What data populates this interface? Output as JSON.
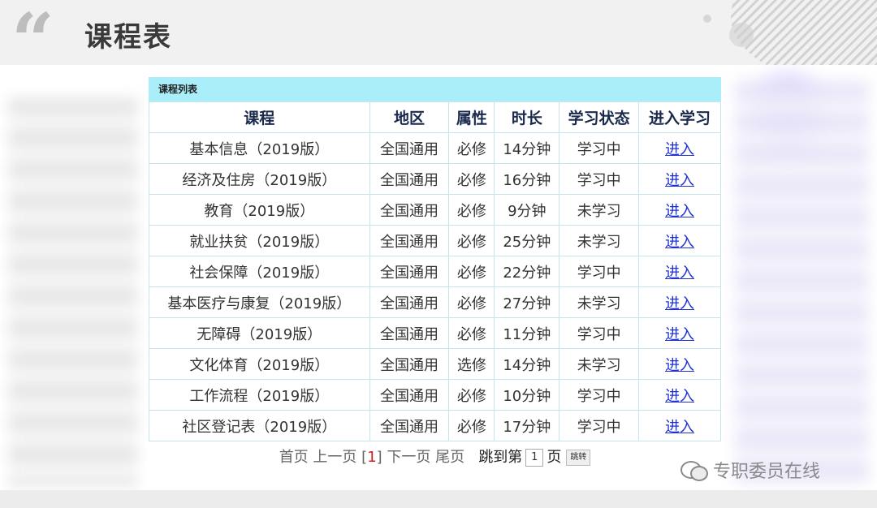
{
  "header": {
    "title": "课程表",
    "quote_mark": "“"
  },
  "panel": {
    "title": "课程列表",
    "columns": [
      "课程",
      "地区",
      "属性",
      "时长",
      "学习状态",
      "进入学习"
    ],
    "rows": [
      [
        "基本信息（2019版）",
        "全国通用",
        "必修",
        "14分钟",
        "学习中",
        "进入"
      ],
      [
        "经济及住房（2019版）",
        "全国通用",
        "必修",
        "16分钟",
        "学习中",
        "进入"
      ],
      [
        "教育（2019版）",
        "全国通用",
        "必修",
        "9分钟",
        "未学习",
        "进入"
      ],
      [
        "就业扶贫（2019版）",
        "全国通用",
        "必修",
        "25分钟",
        "未学习",
        "进入"
      ],
      [
        "社会保障（2019版）",
        "全国通用",
        "必修",
        "22分钟",
        "学习中",
        "进入"
      ],
      [
        "基本医疗与康复（2019版）",
        "全国通用",
        "必修",
        "27分钟",
        "未学习",
        "进入"
      ],
      [
        "无障碍（2019版）",
        "全国通用",
        "必修",
        "11分钟",
        "学习中",
        "进入"
      ],
      [
        "文化体育（2019版）",
        "全国通用",
        "选修",
        "14分钟",
        "未学习",
        "进入"
      ],
      [
        "工作流程（2019版）",
        "全国通用",
        "必修",
        "10分钟",
        "学习中",
        "进入"
      ],
      [
        "社区登记表（2019版）",
        "全国通用",
        "必修",
        "17分钟",
        "学习中",
        "进入"
      ]
    ]
  },
  "pager": {
    "first": "首页",
    "prev": "上一页",
    "current_open": "[",
    "current": "1",
    "current_close": "]",
    "next": "下一页",
    "last": "尾页",
    "jump_prefix": "跳到第",
    "jump_value": "1",
    "jump_suffix": "页",
    "jump_button": "跳转"
  },
  "watermark": {
    "text": "专职委员在线",
    "icon": "wechat-icon"
  },
  "colors": {
    "panel_header_bg": "#a9eef9",
    "link": "#1d2fd6",
    "current_page": "#d12020",
    "table_border": "#c6e4ec"
  }
}
